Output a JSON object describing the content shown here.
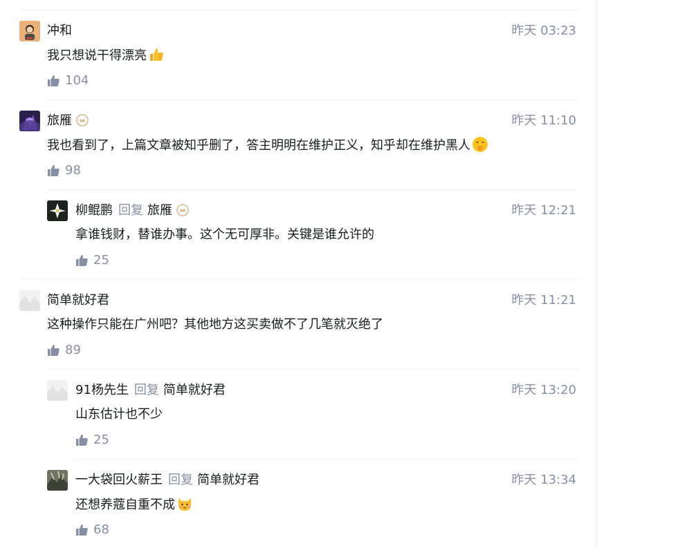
{
  "reply_word": "回复",
  "comments": [
    {
      "user": "冲和",
      "time": "昨天 03:23",
      "text": "我只想说干得漂亮",
      "emoji": "thumbs-up-emoji",
      "likes": "104"
    },
    {
      "user": "旅雁",
      "time": "昨天 11:10",
      "text": "我也看到了，上篇文章被知乎删了，答主明明在维护正义，知乎却在维护黑人",
      "emoji": "hand-over-mouth-emoji",
      "likes": "98"
    },
    {
      "user": "柳鲲鹏",
      "reply_to": "旅雁",
      "time": "昨天 12:21",
      "text": "拿谁钱财，替谁办事。这个无可厚非。关键是谁允许的",
      "likes": "25"
    },
    {
      "user": "简单就好君",
      "time": "昨天 11:21",
      "text": "这种操作只能在广州吧？其他地方这买卖做不了几笔就灭绝了",
      "likes": "89"
    },
    {
      "user": "91杨先生",
      "reply_to": "简单就好君",
      "time": "昨天 13:20",
      "text": "山东估计也不少",
      "likes": "25"
    },
    {
      "user": "一大袋回火薪王",
      "reply_to": "简单就好君",
      "time": "昨天 13:34",
      "text": "还想养蔻自重不成",
      "emoji": "cat-face-emoji",
      "likes": "68"
    }
  ],
  "colors": {
    "meta": "#8590a6",
    "text": "#191b1f",
    "divider": "#f0f2f7",
    "badge": "#d9b98c"
  }
}
